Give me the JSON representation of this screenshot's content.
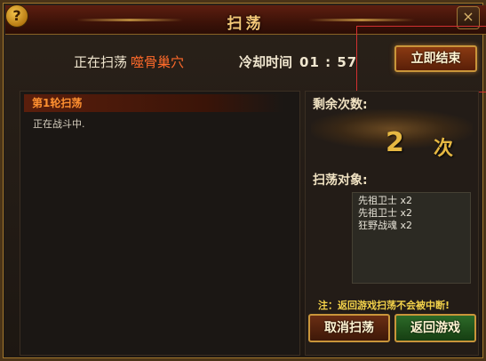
{
  "window": {
    "title": "扫荡"
  },
  "header_icons": {
    "help": "?",
    "close": "×"
  },
  "status": {
    "scanning_label": "正在扫荡",
    "place": "噬骨巢穴",
    "cooldown_label": "冷却时间",
    "cooldown_time": "01 : 57"
  },
  "buttons": {
    "end_now": "立即结束",
    "cancel_scan": "取消扫荡",
    "return_game": "返回游戏"
  },
  "log": {
    "header": "第1轮扫荡",
    "lines": [
      "正在战斗中."
    ]
  },
  "remaining": {
    "label": "剩余次数:",
    "count": "2",
    "unit": "次"
  },
  "targets": {
    "label": "扫荡对象:",
    "items": [
      "先祖卫士 x2",
      "先祖卫士 x2",
      "狂野战魂 x2"
    ]
  },
  "notice": "注：返回游戏扫荡不会被中断!",
  "colors": {
    "place": "#ff6a2a",
    "count": "#e6b842",
    "notice": "#f3d24a",
    "highlight_box": "#d23030"
  }
}
